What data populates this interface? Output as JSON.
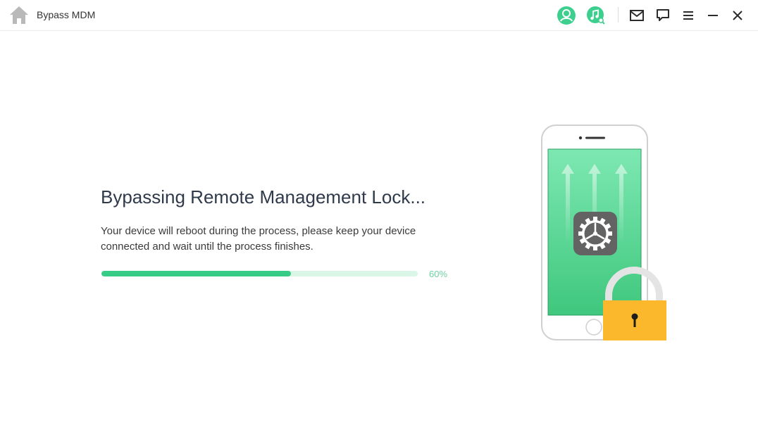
{
  "window": {
    "title": "Bypass MDM"
  },
  "toolbar": {
    "icons": [
      "home-icon",
      "account-icon",
      "music-search-icon",
      "mail-icon",
      "feedback-icon",
      "menu-icon",
      "minimize-icon",
      "close-icon"
    ],
    "accent": "#37cc86"
  },
  "main": {
    "heading": "Bypassing Remote Management Lock...",
    "description": "Your device will reboot during the process, please keep your device connected and wait until the process finishes.",
    "progress": {
      "percent": 60,
      "label": "60%"
    }
  },
  "illustration": {
    "icons": [
      "phone-icon",
      "settings-gear-icon",
      "padlock-icon"
    ]
  }
}
